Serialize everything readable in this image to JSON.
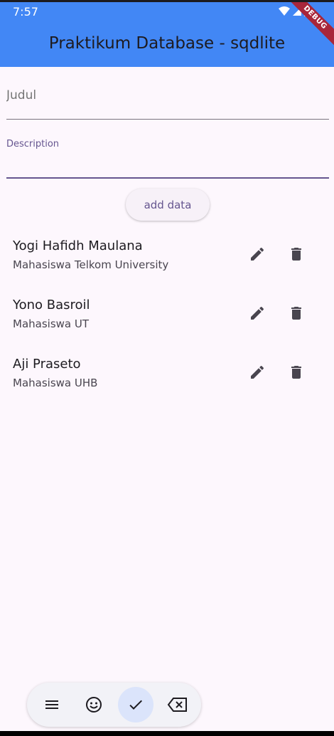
{
  "status_bar": {
    "time": "7:57",
    "icons": [
      "wifi-icon",
      "signal-icon",
      "battery-icon"
    ]
  },
  "debug_banner": "DEBUG",
  "app_bar": {
    "title": "Praktikum Database - sqdlite",
    "color": "#4287f5"
  },
  "form": {
    "judul_placeholder": "Judul",
    "description_label": "Description",
    "add_button": "add data"
  },
  "items": [
    {
      "title": "Yogi Hafidh Maulana",
      "subtitle": "Mahasiswa Telkom University"
    },
    {
      "title": "Yono Basroil",
      "subtitle": "Mahasiswa UT"
    },
    {
      "title": "Aji Praseto",
      "subtitle": "Mahasiswa UHB"
    }
  ],
  "item_actions": [
    "edit-icon",
    "delete-icon"
  ],
  "keyboard_toolbar": [
    "menu-icon",
    "emoji-icon",
    "check-icon",
    "backspace-icon"
  ]
}
